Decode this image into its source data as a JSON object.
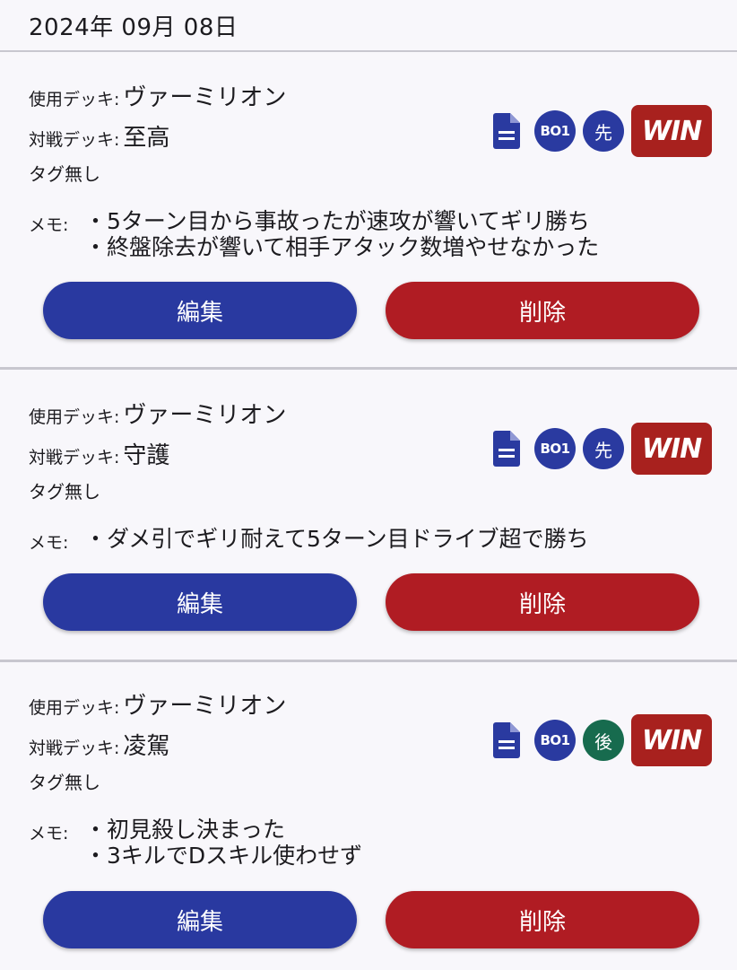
{
  "date": "2024年 09月 08日",
  "labels": {
    "used_deck": "使用デッキ:",
    "opponent_deck": "対戦デッキ:",
    "memo": "メモ:"
  },
  "entries": [
    {
      "used_deck": "ヴァーミリオン",
      "opponent_deck": "至高",
      "tags": "タグ無し",
      "memo": "・5ターン目から事故ったが速攻が響いてギリ勝ち\n・終盤除去が響いて相手アタック数増やせなかった",
      "icon": "document-icon",
      "bo": "BO1",
      "turn": "先",
      "result": "WIN",
      "edit_label": "編集",
      "delete_label": "削除"
    },
    {
      "used_deck": "ヴァーミリオン",
      "opponent_deck": "守護",
      "tags": "タグ無し",
      "memo": "・ダメ引でギリ耐えて5ターン目ドライブ超で勝ち",
      "icon": "document-icon",
      "bo": "BO1",
      "turn": "先",
      "result": "WIN",
      "edit_label": "編集",
      "delete_label": "削除"
    },
    {
      "used_deck": "ヴァーミリオン",
      "opponent_deck": "凌駕",
      "tags": "タグ無し",
      "memo": "・初見殺し決まった\n・3キルでDスキル使わせず",
      "icon": "document-icon",
      "bo": "BO1",
      "turn": "後",
      "result": "WIN",
      "edit_label": "編集",
      "delete_label": "削除"
    }
  ],
  "colors": {
    "primary": "#2939a0",
    "danger": "#b01c23",
    "second_badge": "#176b4e",
    "win_badge": "#a8211e"
  }
}
